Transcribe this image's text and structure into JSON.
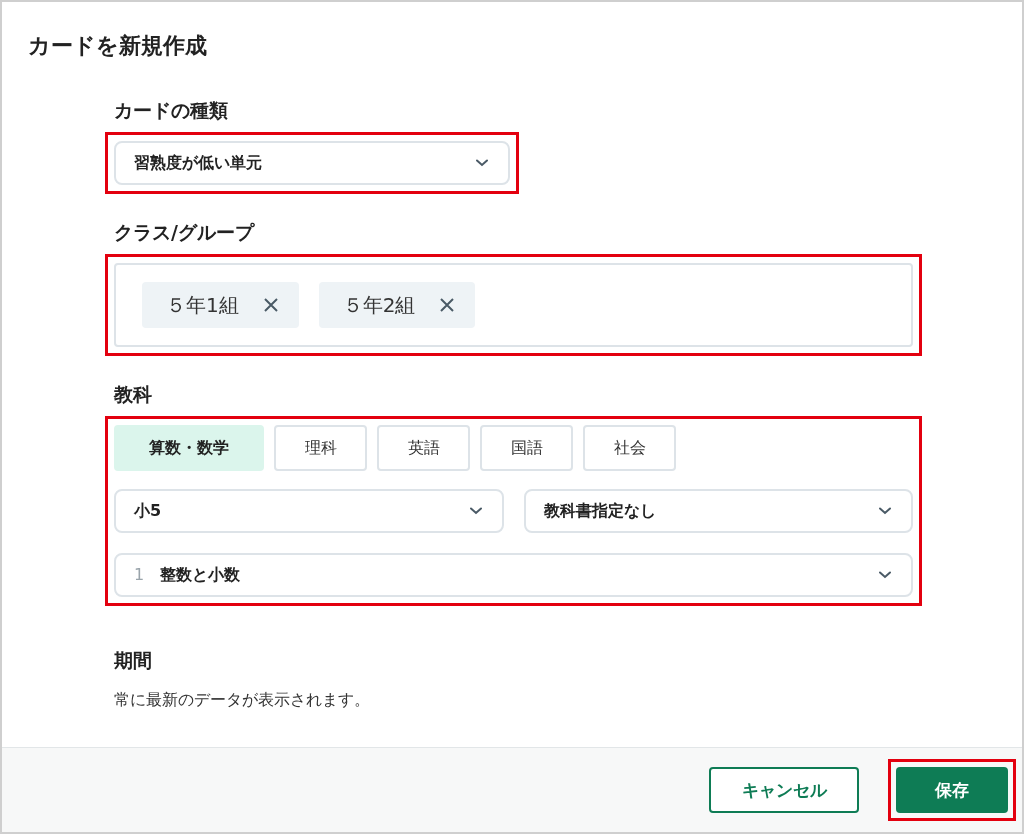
{
  "dialog": {
    "title": "カードを新規作成"
  },
  "sections": [
    {
      "kind": "select",
      "label": "カードの種類",
      "highlighted": true,
      "value": "習熟度が低い単元"
    },
    {
      "kind": "chips",
      "label": "クラス/グループ",
      "highlighted": true,
      "chips": [
        {
          "label": "５年1組"
        },
        {
          "label": "５年2組"
        }
      ]
    },
    {
      "kind": "subject",
      "label": "教科",
      "highlighted": true,
      "tabs": [
        {
          "label": "算数・数学",
          "selected": true
        },
        {
          "label": "理科",
          "selected": false
        },
        {
          "label": "英語",
          "selected": false
        },
        {
          "label": "国語",
          "selected": false
        },
        {
          "label": "社会",
          "selected": false
        }
      ],
      "selects": [
        {
          "value": "小5"
        },
        {
          "value": "教科書指定なし"
        }
      ],
      "unit": {
        "number": "1",
        "value": "整数と小数"
      }
    },
    {
      "kind": "period",
      "label": "期間",
      "description": "常に最新のデータが表示されます。"
    }
  ],
  "footer": {
    "buttons": [
      {
        "label": "キャンセル",
        "kind": "secondary",
        "highlighted": false
      },
      {
        "label": "保存",
        "kind": "primary",
        "highlighted": true
      }
    ]
  }
}
